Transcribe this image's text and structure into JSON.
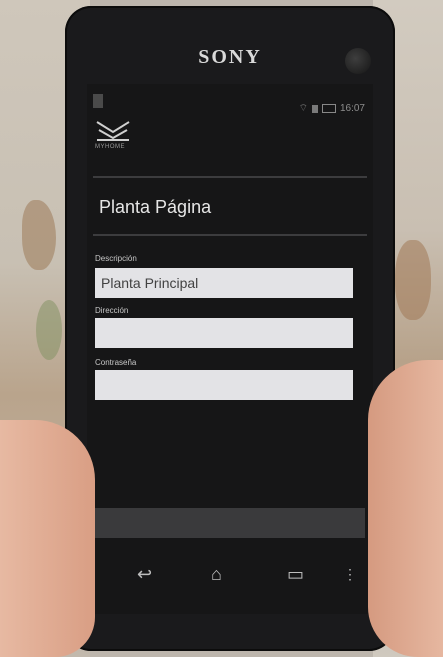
{
  "device": {
    "brand": "SONY"
  },
  "status_bar": {
    "time": "16:07"
  },
  "app": {
    "logo_text": "MYHOME"
  },
  "page": {
    "title": "Planta Página"
  },
  "form": {
    "fields": [
      {
        "label": "Descripción",
        "value": "Planta Principal"
      },
      {
        "label": "Dirección",
        "value": ""
      },
      {
        "label": "Contraseña",
        "value": ""
      }
    ]
  },
  "navigation": {
    "icons": [
      "back-icon",
      "home-icon",
      "recent-apps-icon",
      "menu-icon"
    ]
  }
}
